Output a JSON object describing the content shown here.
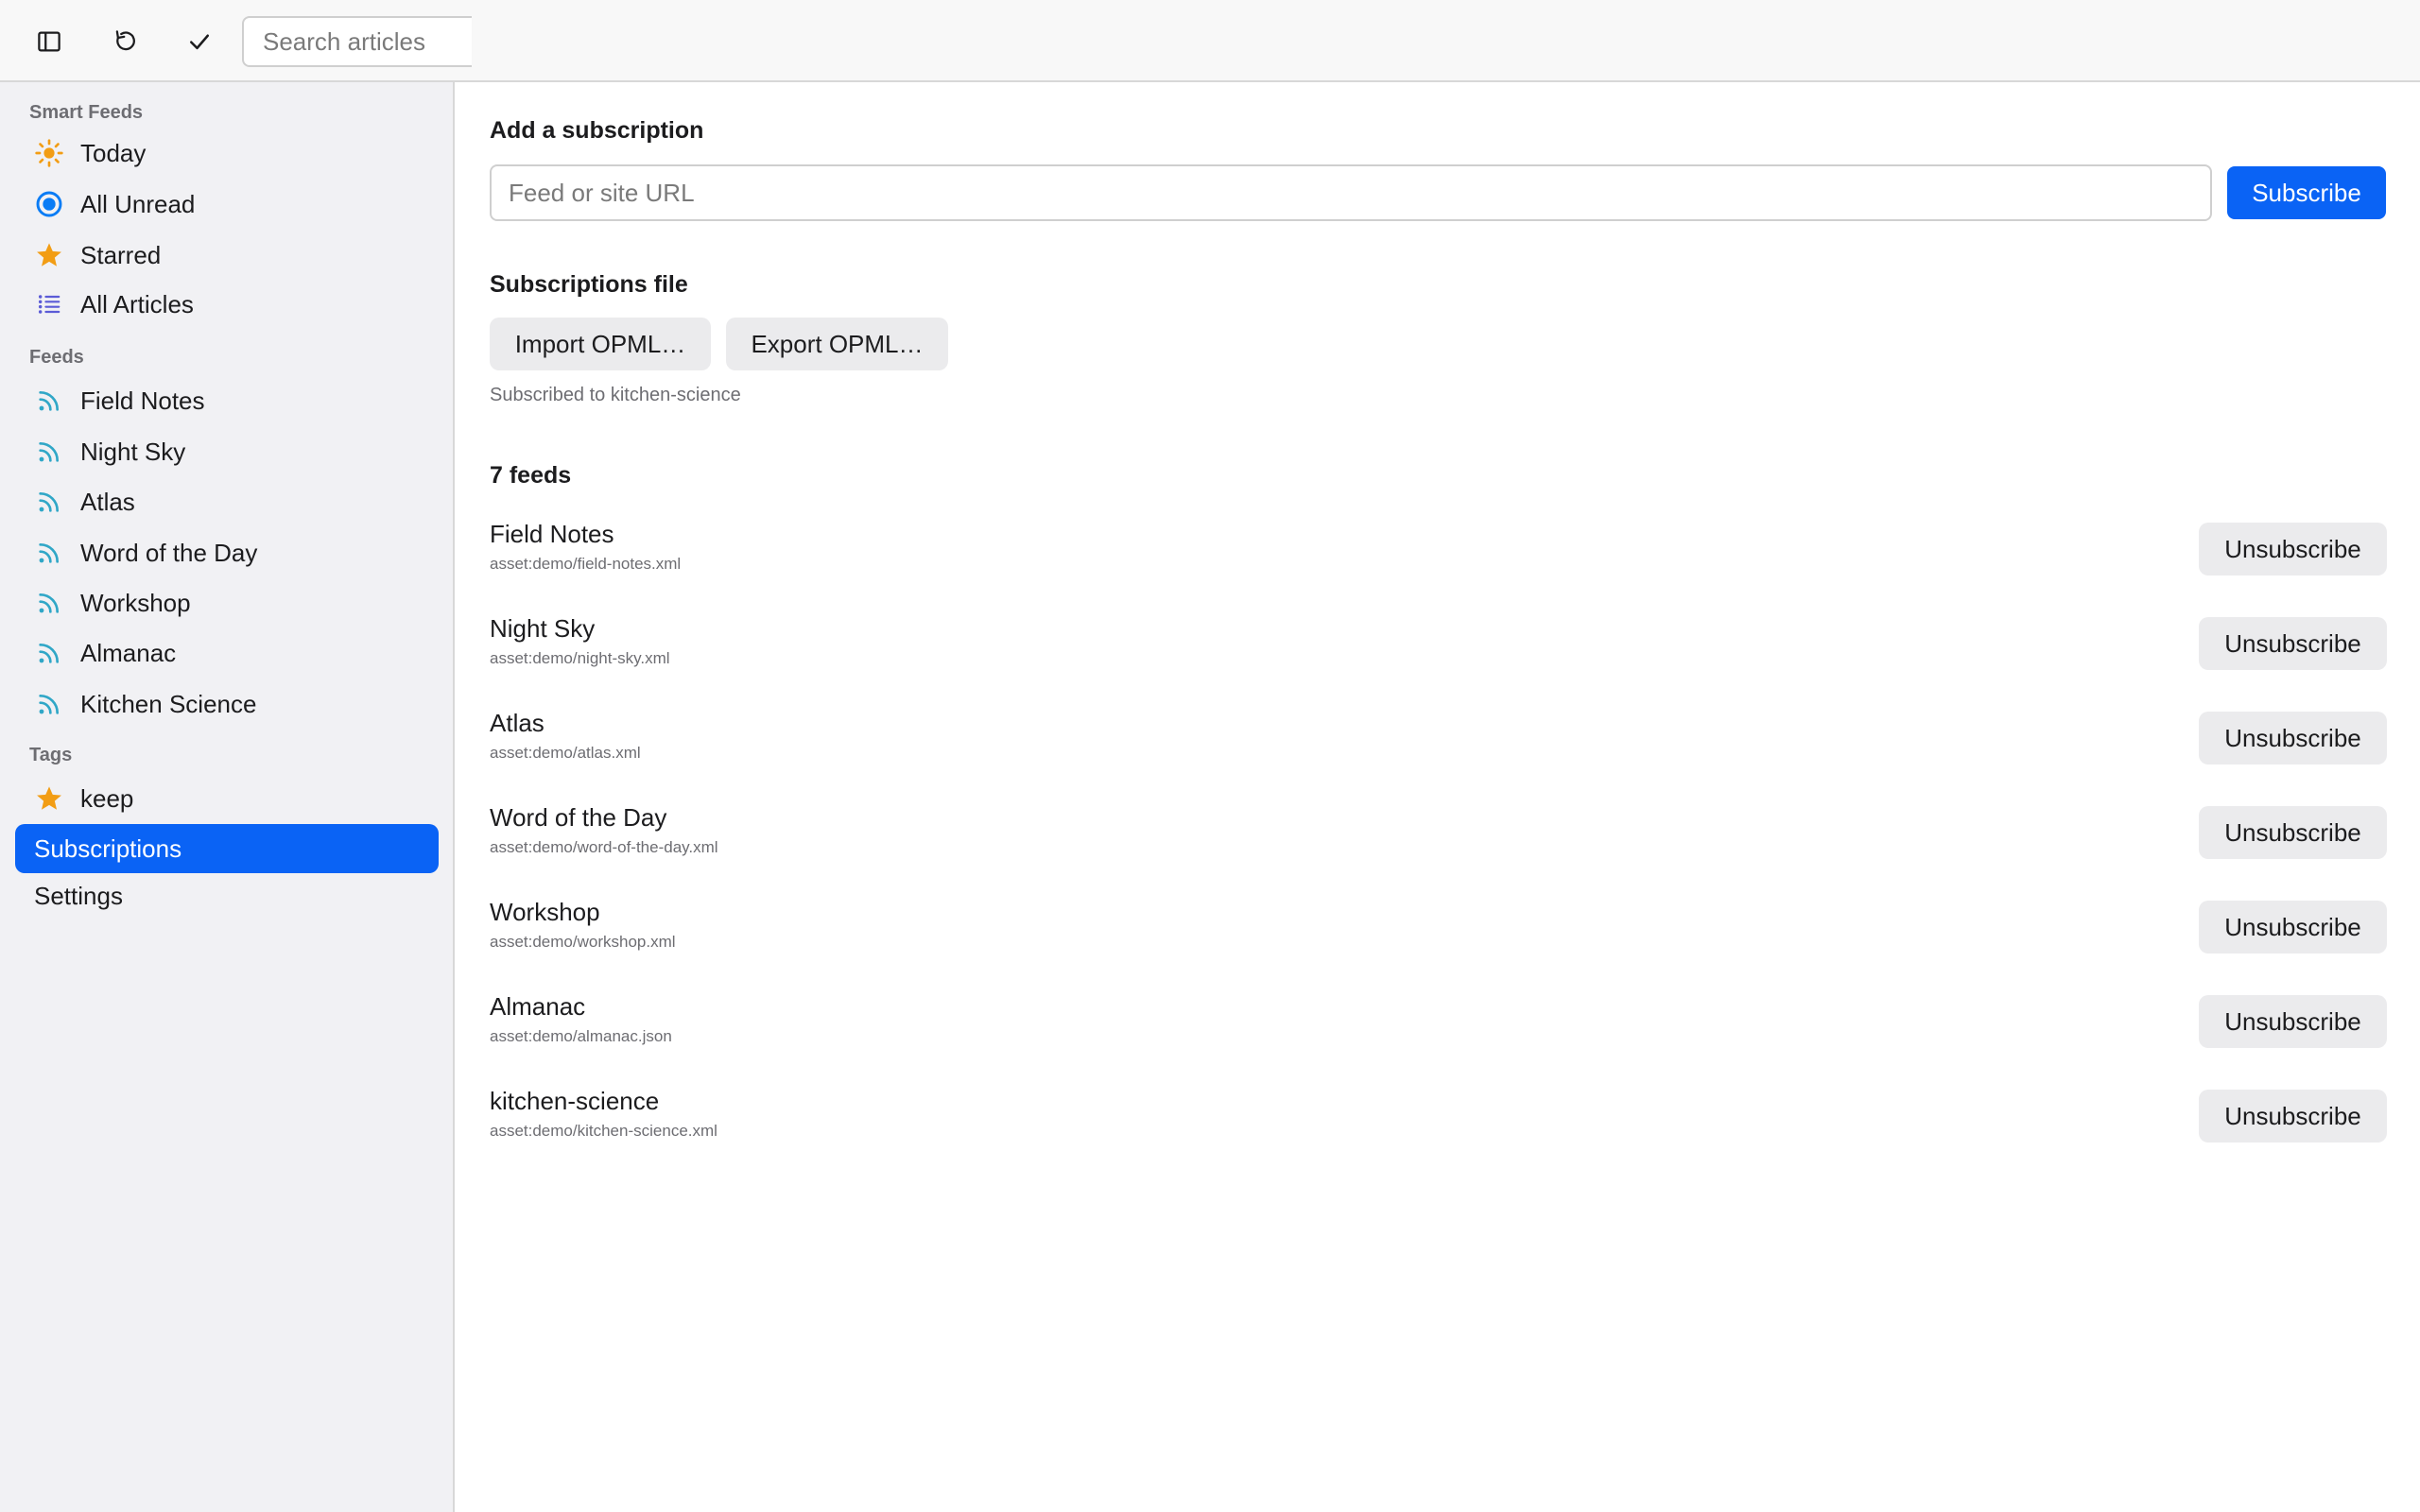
{
  "toolbar": {
    "buttons": [
      {
        "icon": "sidebar-toggle-icon"
      },
      {
        "icon": "refresh-icon"
      },
      {
        "icon": "checkmark-icon"
      }
    ],
    "search_placeholder": "Search articles"
  },
  "sidebar": {
    "smart_feeds_label": "Smart Feeds",
    "smart_feeds": [
      {
        "label": "Today",
        "icon": "sun-icon",
        "color": "#f29d14"
      },
      {
        "label": "All Unread",
        "icon": "unread-dot-icon",
        "color": "#0a7cf5"
      },
      {
        "label": "Starred",
        "icon": "star-icon",
        "color": "#f29d14"
      },
      {
        "label": "All Articles",
        "icon": "list-icon",
        "color": "#5b5bd6"
      }
    ],
    "feeds_label": "Feeds",
    "feeds": [
      {
        "label": "Field Notes",
        "icon": "rss-icon"
      },
      {
        "label": "Night Sky",
        "icon": "rss-icon"
      },
      {
        "label": "Atlas",
        "icon": "rss-icon"
      },
      {
        "label": "Word of the Day",
        "icon": "rss-icon"
      },
      {
        "label": "Workshop",
        "icon": "rss-icon"
      },
      {
        "label": "Almanac",
        "icon": "rss-icon"
      },
      {
        "label": "Kitchen Science",
        "icon": "rss-icon"
      }
    ],
    "feed_icon_color": "#30a7c7",
    "tags_label": "Tags",
    "tags": [
      {
        "label": "keep",
        "icon": "star-icon",
        "color": "#f29d14"
      }
    ],
    "nav": [
      {
        "label": "Subscriptions",
        "active": true
      },
      {
        "label": "Settings",
        "active": false
      }
    ],
    "accent": "#0a63f5"
  },
  "main": {
    "add_heading": "Add a subscription",
    "url_placeholder": "Feed or site URL",
    "subscribe_label": "Subscribe",
    "file_heading": "Subscriptions file",
    "import_label": "Import OPML…",
    "export_label": "Export OPML…",
    "status_text": "Subscribed to kitchen-science",
    "feeds_count_label": "7 feeds",
    "unsubscribe_label": "Unsubscribe",
    "feed_list": [
      {
        "name": "Field Notes",
        "url": "asset:demo/field-notes.xml"
      },
      {
        "name": "Night Sky",
        "url": "asset:demo/night-sky.xml"
      },
      {
        "name": "Atlas",
        "url": "asset:demo/atlas.xml"
      },
      {
        "name": "Word of the Day",
        "url": "asset:demo/word-of-the-day.xml"
      },
      {
        "name": "Workshop",
        "url": "asset:demo/workshop.xml"
      },
      {
        "name": "Almanac",
        "url": "asset:demo/almanac.json"
      },
      {
        "name": "kitchen-science",
        "url": "asset:demo/kitchen-science.xml"
      }
    ]
  }
}
